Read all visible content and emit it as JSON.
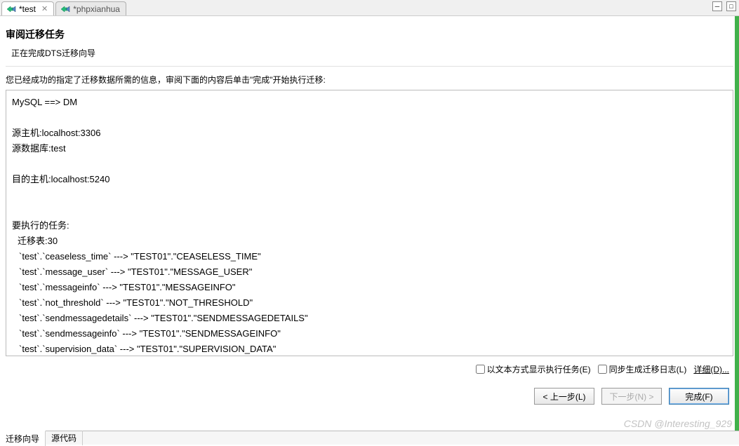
{
  "tabs": {
    "active": {
      "label": "*test"
    },
    "inactive": {
      "label": "*phpxianhua"
    }
  },
  "header": {
    "title": "审阅迁移任务",
    "subtitle": "正在完成DTS迁移向导"
  },
  "instruction": "您已经成功的指定了迁移数据所需的信息，审阅下面的内容后单击\"完成\"开始执行迁移:",
  "review": {
    "direction": "MySQL ==> DM",
    "source_host_label": "源主机:",
    "source_host": "localhost:3306",
    "source_db_label": "源数据库:",
    "source_db": "test",
    "dest_host_label": "目的主机:",
    "dest_host": "localhost:5240",
    "tasks_header": "要执行的任务:",
    "migrate_tables_label": "迁移表:",
    "migrate_tables_count": "30",
    "task_lines": [
      "`test`.`ceaseless_time` ---> \"TEST01\".\"CEASELESS_TIME\"",
      "`test`.`message_user` ---> \"TEST01\".\"MESSAGE_USER\"",
      "`test`.`messageinfo` ---> \"TEST01\".\"MESSAGEINFO\"",
      "`test`.`not_threshold` ---> \"TEST01\".\"NOT_THRESHOLD\"",
      "`test`.`sendmessagedetails` ---> \"TEST01\".\"SENDMESSAGEDETAILS\"",
      "`test`.`sendmessageinfo` ---> \"TEST01\".\"SENDMESSAGEINFO\"",
      "`test`.`supervision_data` ---> \"TEST01\".\"SUPERVISION_DATA\""
    ]
  },
  "options": {
    "checkbox1": "以文本方式显示执行任务(E)",
    "checkbox2": "同步生成迁移日志(L)",
    "details": "详细(D)..."
  },
  "buttons": {
    "back": "< 上一步(L)",
    "next": "下一步(N) >",
    "finish": "完成(F)"
  },
  "bottom_tabs": {
    "wizard": "迁移向导",
    "source": "源代码"
  },
  "watermark": "CSDN @Interesting_929"
}
